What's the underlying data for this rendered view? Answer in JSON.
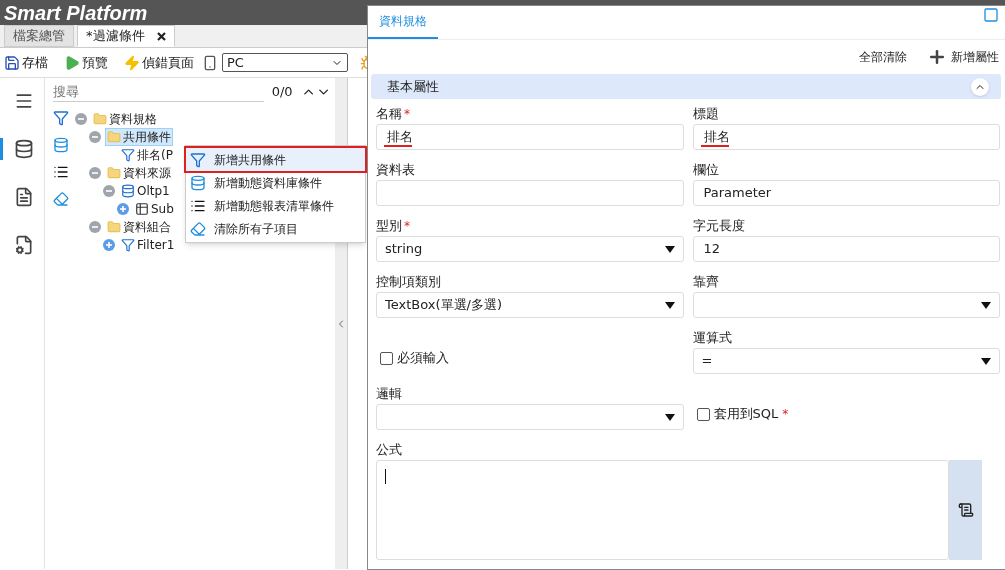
{
  "app": {
    "title": "Smart Platform"
  },
  "tabs": [
    {
      "label": "檔案總管",
      "selected": false,
      "closable": false
    },
    {
      "label": "*過濾條件",
      "selected": true,
      "closable": true
    }
  ],
  "toolbar": {
    "buttons": [
      {
        "kind": "save",
        "label": "存檔"
      },
      {
        "kind": "preview",
        "label": "預覽"
      },
      {
        "kind": "debug",
        "label": "偵錯頁面"
      }
    ],
    "device": {
      "value": "PC"
    }
  },
  "sidebar": {
    "items": [
      {
        "kind": "menu",
        "selected": false
      },
      {
        "kind": "database",
        "selected": true
      },
      {
        "kind": "chart",
        "selected": false
      },
      {
        "kind": "settings",
        "selected": false
      }
    ]
  },
  "search": {
    "placeholder": "搜尋",
    "count": "0/0"
  },
  "tree_tools": [
    {
      "kind": "filter-add"
    },
    {
      "kind": "db-filter"
    },
    {
      "kind": "list"
    },
    {
      "kind": "eraser"
    }
  ],
  "tree": [
    {
      "label": "資料規格",
      "kind": "folder",
      "expanded": true,
      "selected": false,
      "children": [
        {
          "label": "共用條件",
          "kind": "folder",
          "expanded": true,
          "selected": true,
          "children": [
            {
              "label": "排名(P",
              "kind": "filter",
              "selected": false
            }
          ]
        },
        {
          "label": "資料來源",
          "kind": "folder",
          "expanded": true,
          "selected": false,
          "children": [
            {
              "label": "Oltp1",
              "kind": "database",
              "expanded": true,
              "selected": false,
              "children": [
                {
                  "label": "Sub",
                  "kind": "table",
                  "expanded": false,
                  "selected": false
                }
              ]
            }
          ]
        },
        {
          "label": "資料組合",
          "kind": "folder",
          "expanded": true,
          "selected": false,
          "children": [
            {
              "label": "Filter1",
              "kind": "filter",
              "expanded": false,
              "selected": false
            }
          ]
        }
      ]
    }
  ],
  "context_menu": {
    "items": [
      {
        "kind": "filter-add",
        "label": "新增共用條件",
        "selected": true
      },
      {
        "kind": "db-filter",
        "label": "新增動態資料庫條件",
        "selected": false
      },
      {
        "kind": "list",
        "label": "新增動態報表清單條件",
        "selected": false
      },
      {
        "kind": "eraser",
        "label": "清除所有子項目",
        "selected": false
      }
    ]
  },
  "dialog": {
    "tab": "資料規格",
    "actions": [
      {
        "kind": "clear",
        "label": "全部清除"
      },
      {
        "kind": "add",
        "label": "新增屬性"
      }
    ],
    "section": {
      "title": "基本屬性",
      "expanded": true
    },
    "fields": [
      {
        "kind": "text",
        "label": "名稱",
        "mark": "*",
        "value": "排名",
        "underlined": true
      },
      {
        "kind": "text",
        "label": "標題",
        "value": "排名",
        "underlined": true
      },
      {
        "kind": "text",
        "label": "資料表"
      },
      {
        "kind": "text",
        "label": "欄位",
        "value": "Parameter"
      },
      {
        "kind": "select",
        "label": "型別",
        "mark": "*",
        "value": "string"
      },
      {
        "kind": "text",
        "label": "字元長度",
        "value": "12"
      },
      {
        "kind": "select",
        "label": "控制項類別",
        "value": "TextBox(單選/多選)"
      },
      {
        "kind": "select",
        "label": "靠齊"
      },
      {
        "kind": "checkbox",
        "label": "必須輸入",
        "checked": false
      },
      {
        "kind": "select",
        "label": "運算式",
        "value": "="
      },
      {
        "kind": "select",
        "label": "邏輯"
      },
      {
        "kind": "checkbox",
        "label": "套用到SQL",
        "mark": "*",
        "checked": false
      }
    ],
    "formula": {
      "label": "公式",
      "focused": true
    }
  }
}
